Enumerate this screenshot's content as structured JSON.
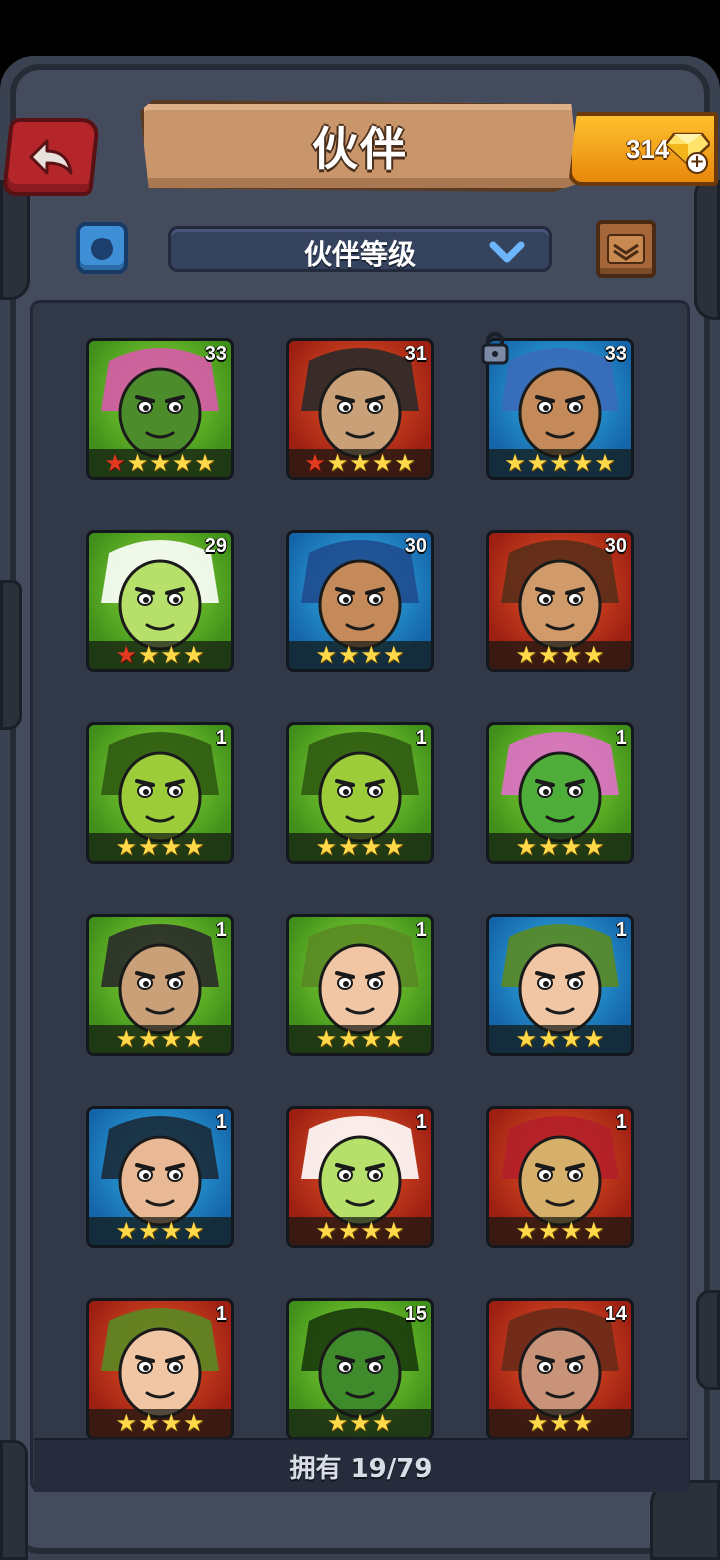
{
  "header": {
    "title": "伙伴",
    "gems": "314"
  },
  "toolbar": {
    "sort_label": "伙伴等级"
  },
  "heroes": [
    {
      "level": "33",
      "bg": "green",
      "face": "boar",
      "stars": 5,
      "red_stars": 1
    },
    {
      "level": "31",
      "bg": "red",
      "face": "totem",
      "stars": 5,
      "red_stars": 1
    },
    {
      "level": "33",
      "bg": "blue",
      "face": "brute",
      "stars": 5,
      "red_stars": 0,
      "locked": true
    },
    {
      "level": "29",
      "bg": "green",
      "face": "lizard",
      "stars": 4,
      "red_stars": 1
    },
    {
      "level": "30",
      "bg": "blue",
      "face": "warrior",
      "stars": 4,
      "red_stars": 0
    },
    {
      "level": "30",
      "bg": "red",
      "face": "rogue",
      "stars": 4,
      "red_stars": 0
    },
    {
      "level": "1",
      "bg": "green",
      "face": "goblin",
      "stars": 4,
      "red_stars": 0
    },
    {
      "level": "1",
      "bg": "green",
      "face": "goblin",
      "stars": 4,
      "red_stars": 0
    },
    {
      "level": "1",
      "bg": "green",
      "face": "frog",
      "stars": 4,
      "red_stars": 0
    },
    {
      "level": "1",
      "bg": "green",
      "face": "totem",
      "stars": 4,
      "red_stars": 0
    },
    {
      "level": "1",
      "bg": "green",
      "face": "girl",
      "stars": 4,
      "red_stars": 0
    },
    {
      "level": "1",
      "bg": "blue",
      "face": "girl",
      "stars": 4,
      "red_stars": 0
    },
    {
      "level": "1",
      "bg": "blue",
      "face": "huntress",
      "stars": 4,
      "red_stars": 0
    },
    {
      "level": "1",
      "bg": "red",
      "face": "lizard",
      "stars": 4,
      "red_stars": 0
    },
    {
      "level": "1",
      "bg": "red",
      "face": "scarecrow",
      "stars": 4,
      "red_stars": 0
    },
    {
      "level": "1",
      "bg": "red",
      "face": "girl",
      "stars": 4,
      "red_stars": 0
    },
    {
      "level": "15",
      "bg": "green",
      "face": "croc",
      "stars": 3,
      "red_stars": 0
    },
    {
      "level": "14",
      "bg": "red",
      "face": "ogre",
      "stars": 3,
      "red_stars": 0
    }
  ],
  "footer": {
    "owned_label": "拥有 19/79"
  },
  "colors": {
    "gold": "#ffd94a",
    "red_star": "#e23a1f",
    "panel": "#313848"
  },
  "icons": {
    "back": "back-arrow-icon",
    "gem": "gem-icon",
    "category": "category-icon",
    "map": "map-icon",
    "lock": "lock-icon"
  }
}
